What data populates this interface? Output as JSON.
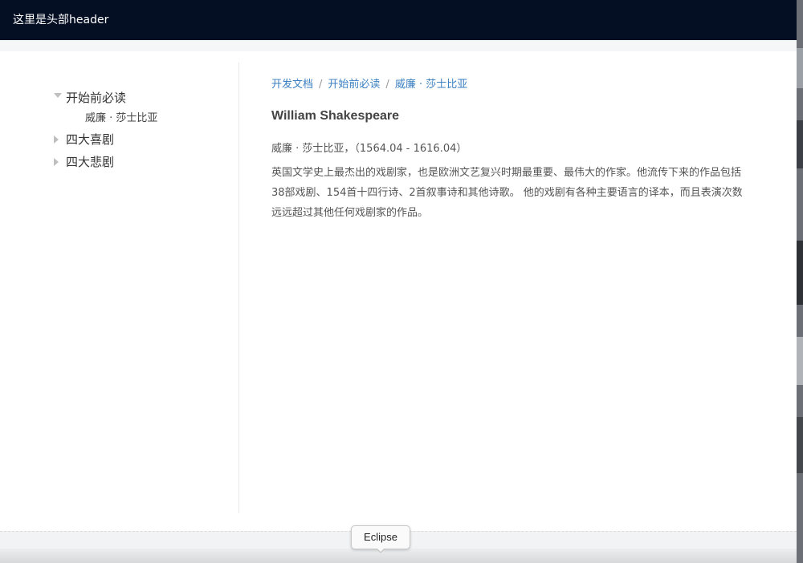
{
  "header": {
    "title": "这里是头部header"
  },
  "sidebar": {
    "tree": [
      {
        "label": "开始前必读",
        "expanded": true,
        "children": [
          {
            "label": "威廉 · 莎士比亚"
          }
        ]
      },
      {
        "label": "四大喜剧",
        "expanded": false
      },
      {
        "label": "四大悲剧",
        "expanded": false
      }
    ]
  },
  "main": {
    "breadcrumb": [
      "开发文档",
      "开始前必读",
      "威廉 · 莎士比亚"
    ],
    "breadcrumb_sep": "/",
    "title": "William Shakespeare",
    "subtitle": "威廉 · 莎士比亚，（1564.04 - 1616.04）",
    "paragraph": "英国文学史上最杰出的戏剧家，也是欧洲文艺复兴时期最重要、最伟大的作家。他流传下来的作品包括38部戏剧、154首十四行诗、2首叙事诗和其他诗歌。 他的戏剧有各种主要语言的译本，而且表演次数远远超过其他任何戏剧家的作品。"
  },
  "tooltip": {
    "text": "Eclipse"
  },
  "colors": {
    "header_bg": "#050f24",
    "link": "#3a7fc1"
  }
}
